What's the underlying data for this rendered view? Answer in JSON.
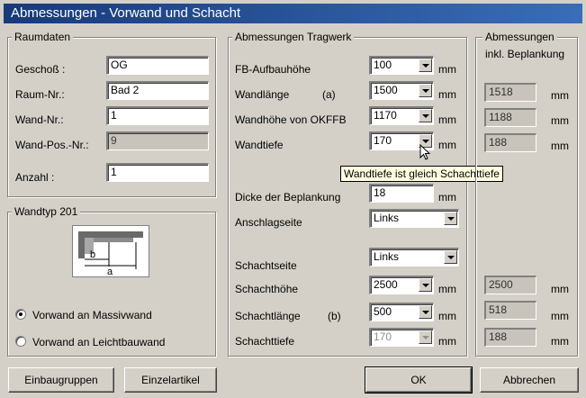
{
  "window": {
    "title": "Abmessungen - Vorwand und Schacht"
  },
  "raumdaten": {
    "title": "Raumdaten",
    "fields": [
      {
        "label": "Geschoß :",
        "value": "OG"
      },
      {
        "label": "Raum-Nr.:",
        "value": "Bad 2"
      },
      {
        "label": "Wand-Nr.:",
        "value": "1"
      },
      {
        "label": "Wand-Pos.-Nr.:",
        "value": "9"
      },
      {
        "label": "Anzahl :",
        "value": "1"
      }
    ]
  },
  "wandtyp": {
    "title": "Wandtyp 201",
    "diagram_labels": {
      "b": "b",
      "a": "a"
    },
    "options": [
      {
        "label": "Vorwand an Massivwand",
        "selected": true
      },
      {
        "label": "Vorwand an Leichtbauwand",
        "selected": false
      }
    ]
  },
  "tragwerk": {
    "title": "Abmessungen Tragwerk",
    "rows": [
      {
        "label": "FB-Aufbauhöhe",
        "tag": "",
        "value": "100",
        "unit": "mm",
        "enabled": true
      },
      {
        "label": "Wandlänge",
        "tag": "(a)",
        "value": "1500",
        "unit": "mm",
        "enabled": true
      },
      {
        "label": "Wandhöhe von OKFFB",
        "tag": "",
        "value": "1170",
        "unit": "mm",
        "enabled": true
      },
      {
        "label": "Wandtiefe",
        "tag": "",
        "value": "170",
        "unit": "mm",
        "enabled": true
      },
      {
        "label": "Dicke der Beplankung",
        "tag": "",
        "value": "18",
        "unit": "mm",
        "enabled": true
      },
      {
        "label": "Anschlagseite",
        "tag": "",
        "value": "Links",
        "unit": "",
        "enabled": true
      },
      {
        "label": "Schachtseite",
        "tag": "",
        "value": "Links",
        "unit": "",
        "enabled": true
      },
      {
        "label": "Schachthöhe",
        "tag": "",
        "value": "2500",
        "unit": "mm",
        "enabled": true
      },
      {
        "label": "Schachtlänge",
        "tag": "(b)",
        "value": "500",
        "unit": "mm",
        "enabled": true
      },
      {
        "label": "Schachttiefe",
        "tag": "",
        "value": "170",
        "unit": "mm",
        "enabled": false
      }
    ],
    "tooltip": "Wandtiefe  ist gleich Schachttiefe"
  },
  "beplankung": {
    "title_line1": "Abmessungen",
    "title_line2": "inkl. Beplankung",
    "values": [
      {
        "value": "1518",
        "unit": "mm"
      },
      {
        "value": "1188",
        "unit": "mm"
      },
      {
        "value": "188",
        "unit": "mm"
      },
      {
        "value": "2500",
        "unit": "mm"
      },
      {
        "value": "518",
        "unit": "mm"
      },
      {
        "value": "188",
        "unit": "mm"
      }
    ]
  },
  "buttons": {
    "einbaugruppen": "Einbaugruppen",
    "einzelartikel": "Einzelartikel",
    "ok": "OK",
    "abbrechen": "Abbrechen"
  }
}
